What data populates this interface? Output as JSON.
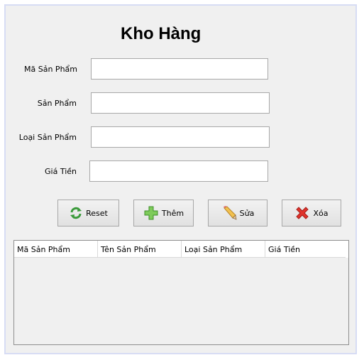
{
  "form": {
    "title": "Kho Hàng",
    "fields": [
      {
        "label": "Mã Sản Phẩm",
        "value": ""
      },
      {
        "label": "Sản Phẩm",
        "value": ""
      },
      {
        "label": "Loại Sản Phẩm",
        "value": ""
      },
      {
        "label": "Giá Tiền",
        "value": ""
      }
    ]
  },
  "buttons": {
    "reset": {
      "label": "Reset",
      "icon": "refresh-icon"
    },
    "add": {
      "label": "Thêm",
      "icon": "plus-icon"
    },
    "edit": {
      "label": "Sửa",
      "icon": "pencil-icon"
    },
    "delete": {
      "label": "Xóa",
      "icon": "x-icon"
    }
  },
  "table": {
    "columns": [
      "Mã Sản Phẩm",
      "Tên Sản Phẩm",
      "Loại Sản Phẩm",
      "Giá Tiền"
    ],
    "rows": []
  }
}
